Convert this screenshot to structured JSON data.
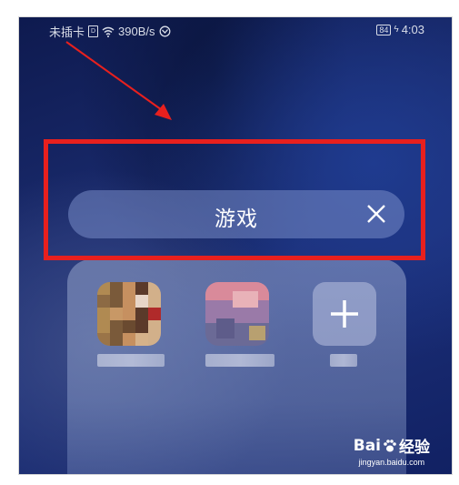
{
  "status_bar": {
    "carrier": "未插卡",
    "sim": "D",
    "speed": "390B/s",
    "battery": "84",
    "time": "4:03"
  },
  "folder": {
    "title": "游戏",
    "apps": [
      {
        "icon": "game-app-1-icon"
      },
      {
        "icon": "game-app-2-icon"
      },
      {
        "icon": "plus-icon"
      }
    ]
  },
  "watermark": {
    "brand_left": "Bai",
    "brand_right": "经验",
    "url": "jingyan.baidu.com"
  },
  "colors": {
    "highlight": "#e8201e",
    "wallpaper": "#1a2b6e"
  }
}
